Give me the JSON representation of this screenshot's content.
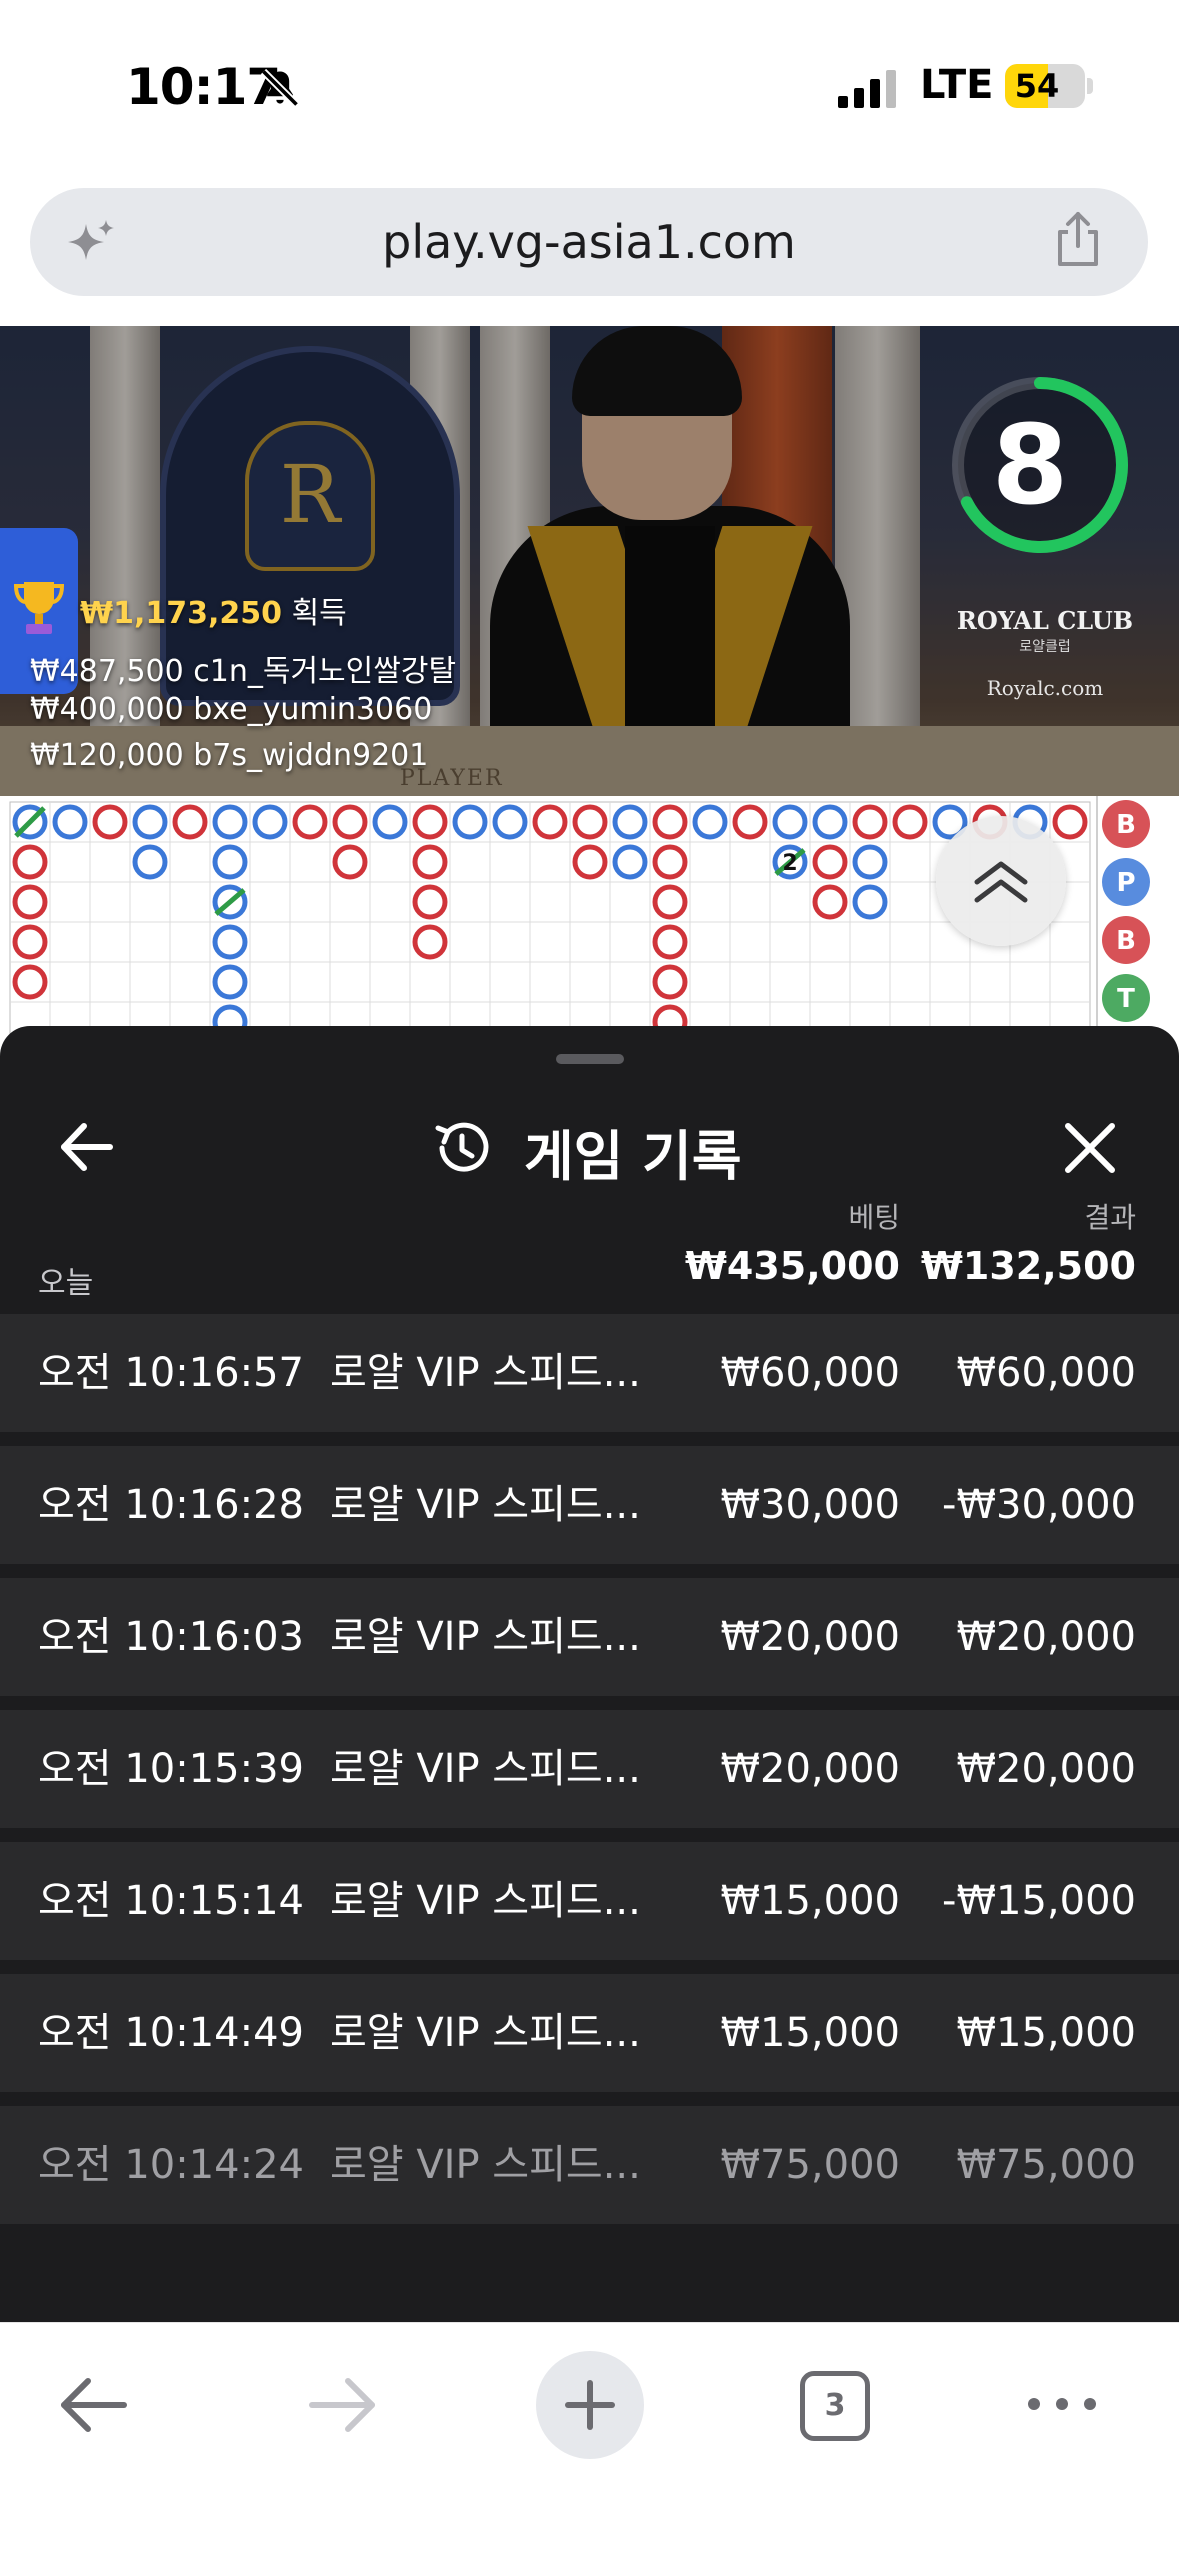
{
  "status_bar": {
    "time": "10:17",
    "network": "LTE",
    "battery": "54",
    "battery_level": 0.54
  },
  "browser": {
    "url": "play.vg-asia1.com"
  },
  "video": {
    "countdown": "8",
    "brand_name": "ROYAL CLUB",
    "brand_subtitle": "로얄클럽",
    "brand_url": "Royalc.com",
    "table_label": "PLAYER",
    "winners": {
      "top_amount": "₩1,173,250",
      "top_label": "획득",
      "rows": [
        "₩487,500  c1n_독거노인쌀강탈",
        "₩400,000  bxe_yumin3060",
        "₩120,000  b7s_wjddn9201"
      ]
    }
  },
  "roadmap": {
    "side_labels": [
      "B",
      "P",
      "B",
      "T"
    ],
    "tie_count_label": "2",
    "colors": {
      "banker": "#d0343a",
      "player": "#3b78d8",
      "tie": "#2e9b46"
    }
  },
  "sheet": {
    "title": "게임 기록",
    "col_bet": "베팅",
    "col_result": "결과",
    "today_label": "오늘",
    "total_bet": "₩435,000",
    "total_result": "₩132,500",
    "rows": [
      {
        "time": "오전 10:16:57",
        "game": "로얄 VIP 스피드...",
        "bet": "₩60,000",
        "result": "₩60,000"
      },
      {
        "time": "오전 10:16:28",
        "game": "로얄 VIP 스피드...",
        "bet": "₩30,000",
        "result": "-₩30,000"
      },
      {
        "time": "오전 10:16:03",
        "game": "로얄 VIP 스피드...",
        "bet": "₩20,000",
        "result": "₩20,000"
      },
      {
        "time": "오전 10:15:39",
        "game": "로얄 VIP 스피드...",
        "bet": "₩20,000",
        "result": "₩20,000"
      },
      {
        "time": "오전 10:15:14",
        "game": "로얄 VIP 스피드...",
        "bet": "₩15,000",
        "result": "-₩15,000"
      },
      {
        "time": "오전 10:14:49",
        "game": "로얄 VIP 스피드...",
        "bet": "₩15,000",
        "result": "₩15,000"
      },
      {
        "time": "오전 10:14:24",
        "game": "로얄 VIP 스피드...",
        "bet": "₩75,000",
        "result": "₩75,000"
      }
    ]
  },
  "nav": {
    "tab_count": "3"
  }
}
